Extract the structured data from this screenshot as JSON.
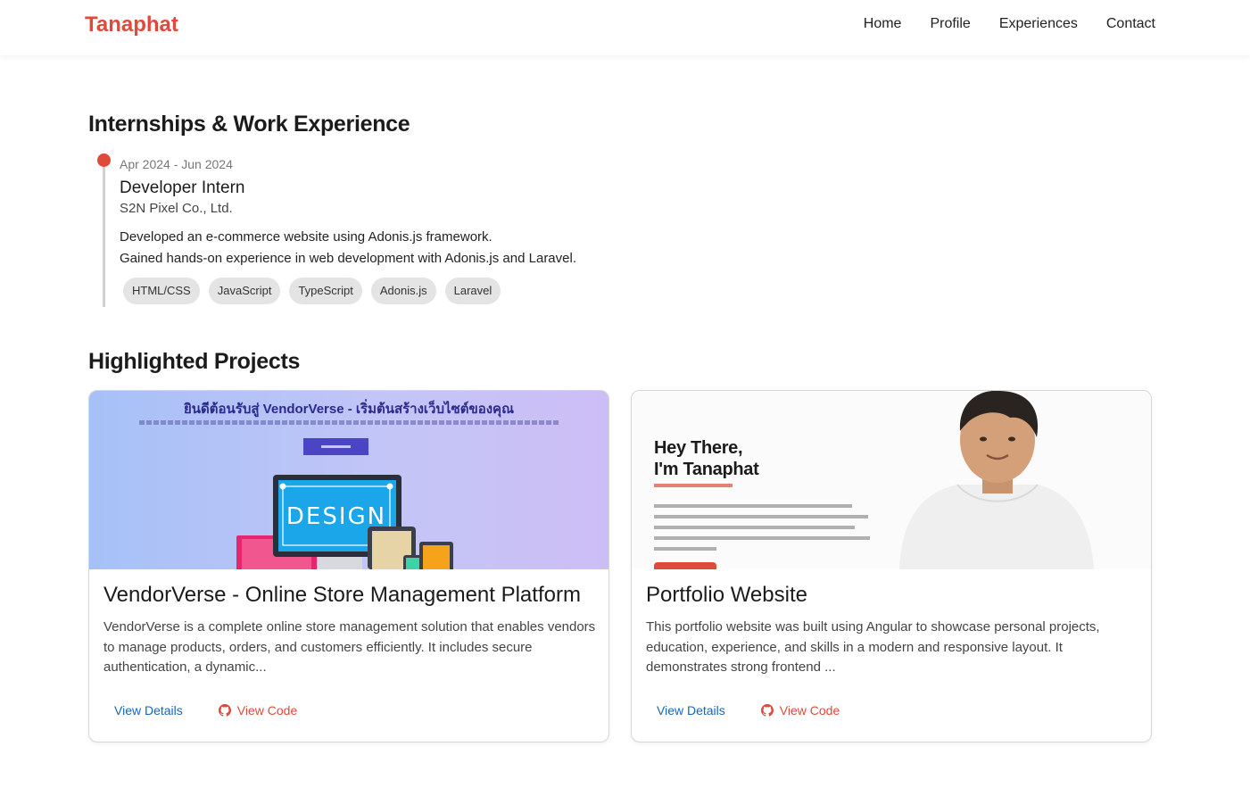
{
  "nav": {
    "brand": "Tanaphat",
    "links": [
      "Home",
      "Profile",
      "Experiences",
      "Contact"
    ]
  },
  "experience": {
    "title": "Internships & Work Experience",
    "items": [
      {
        "date": "Apr 2024 - Jun 2024",
        "role": "Developer Intern",
        "company": "S2N Pixel Co., Ltd.",
        "description": [
          "Developed an e-commerce website using Adonis.js framework.",
          "Gained hands-on experience in web development with Adonis.js and Laravel."
        ],
        "tags": [
          "HTML/CSS",
          "JavaScript",
          "TypeScript",
          "Adonis.js",
          "Laravel"
        ]
      }
    ]
  },
  "projects": {
    "title": "Highlighted Projects",
    "items": [
      {
        "title": "VendorVerse - Online Store Management Platform",
        "description": "VendorVerse is a complete online store management solution that enables vendors to manage products, orders, and customers efficiently. It includes secure authentication, a dynamic...",
        "details_label": "View Details",
        "code_label": "View Code",
        "thumbnail": {
          "heading": "ยินดีต้อนรับสู่ VendorVerse - เริ่มต้นสร้างเว็บไซต์ของคุณ",
          "screen_text": "DESIGN"
        }
      },
      {
        "title": "Portfolio Website",
        "description": "This portfolio website was built using Angular to showcase personal projects, education, experience, and skills in a modern and responsive layout. It demonstrates strong frontend ...",
        "details_label": "View Details",
        "code_label": "View Code",
        "thumbnail": {
          "greeting_line1": "Hey There,",
          "greeting_line2": "I'm Tanaphat"
        }
      }
    ]
  },
  "colors": {
    "accent": "#e04a3a",
    "link": "#1565c0",
    "tag_bg": "#e4e4e4"
  },
  "icons": {
    "code": "github-icon"
  }
}
